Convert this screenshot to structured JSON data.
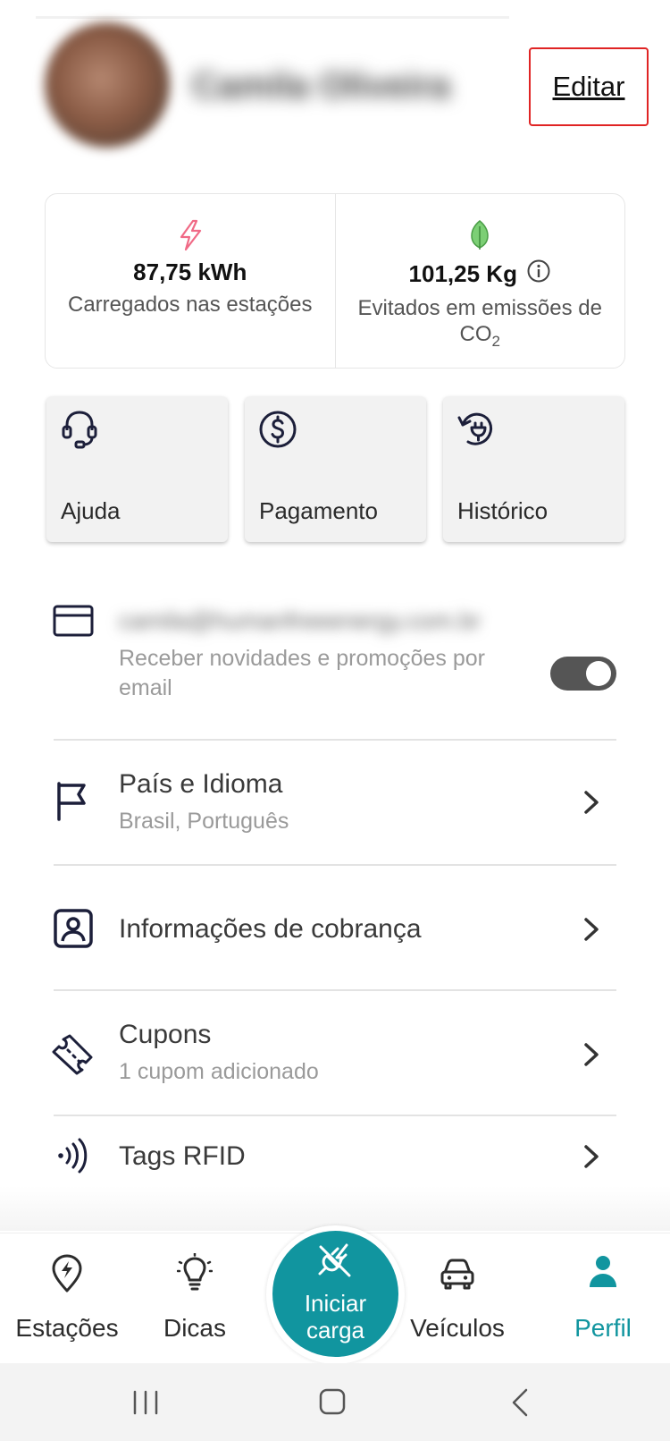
{
  "profile": {
    "name": "Camila Oliveira",
    "edit_label": "Editar"
  },
  "stats": {
    "energy": {
      "icon": "lightning-bolt-icon",
      "value": "87,75 kWh",
      "label": "Carregados nas estações"
    },
    "co2": {
      "icon": "leaf-icon",
      "value": "101,25 Kg",
      "label_main": "Evitados em emissões de CO",
      "label_sub": "2",
      "info_icon": "info-icon"
    }
  },
  "shortcuts": [
    {
      "icon": "headset-icon",
      "label": "Ajuda"
    },
    {
      "icon": "dollar-coin-icon",
      "label": "Pagamento"
    },
    {
      "icon": "history-plug-icon",
      "label": "Histórico"
    }
  ],
  "email": {
    "address": "camila@humanfreeenergy.com.br",
    "promo_label": "Receber novidades e promoções por email",
    "toggle_on": true
  },
  "menu": {
    "country": {
      "title": "País e Idioma",
      "subtitle": "Brasil, Português"
    },
    "billing": {
      "title": "Informações de cobrança"
    },
    "coupons": {
      "title": "Cupons",
      "subtitle": "1 cupom adicionado"
    },
    "rfid": {
      "title": "Tags RFID"
    }
  },
  "nav": {
    "stations": "Estações",
    "tips": "Dicas",
    "start_charge": "Iniciar carga",
    "vehicles": "Veículos",
    "profile": "Perfil",
    "active": "profile"
  },
  "colors": {
    "accent": "#11959f",
    "edit_border": "#e02424",
    "bolt": "#f06a86",
    "leaf": "#5cb85c",
    "icon_dark": "#1c1f3a"
  }
}
